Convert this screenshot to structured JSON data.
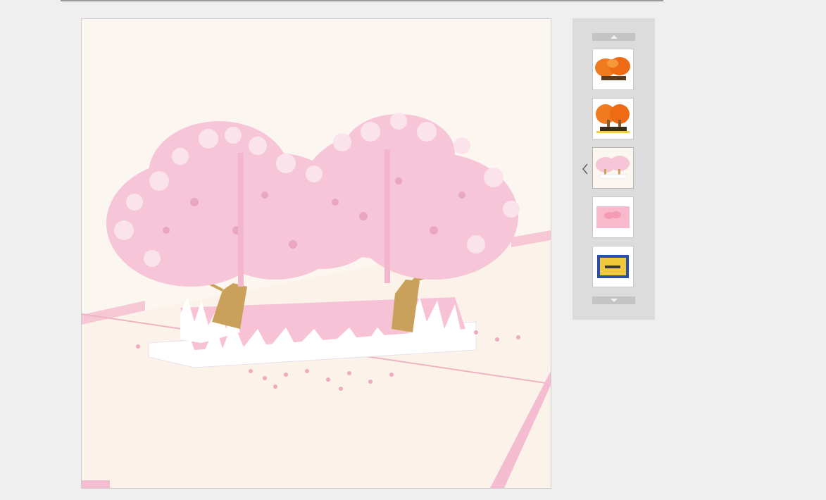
{
  "gallery": {
    "main_image_icon": "pop-up-cherry-blossom-card-image",
    "active_thumbnail_index": 2,
    "thumbnails": [
      {
        "icon": "orange-tree-card-thumbnail"
      },
      {
        "icon": "orange-tree-card-thumbnail"
      },
      {
        "icon": "pink-cherry-blossom-card-thumbnail"
      },
      {
        "icon": "pink-card-cover-thumbnail"
      },
      {
        "icon": "blue-yellow-envelope-thumbnail"
      }
    ],
    "controls": {
      "scroll_up_icon": "triangle-up-icon",
      "scroll_down_icon": "triangle-down-icon",
      "previous_icon": "chevron-left-icon"
    },
    "colors": {
      "page_background": "#efefef",
      "panel_background": "#dcdcdc",
      "blossom_pink": "#f6c6d8",
      "trunk_gold": "#c9a15a"
    }
  }
}
